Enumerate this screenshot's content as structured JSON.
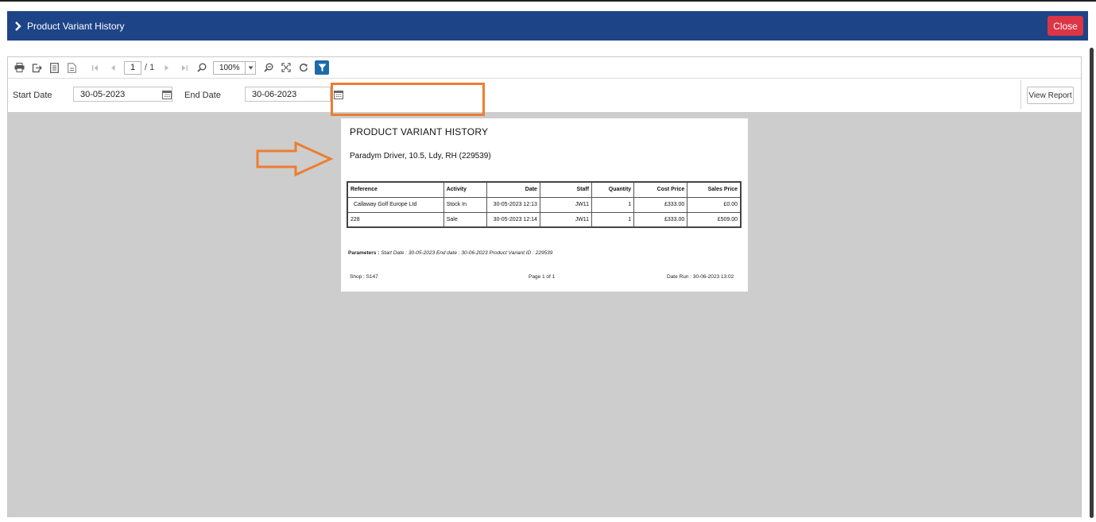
{
  "header": {
    "title": "Product Variant History",
    "close_label": "Close",
    "color": "#1e4488",
    "close_color": "#dc3545"
  },
  "toolbar": {
    "icons": [
      "print-icon",
      "export-icon",
      "document-map-icon",
      "page-setup-icon",
      "first-page-icon",
      "prev-page-icon",
      "next-page-icon",
      "last-page-icon",
      "search-icon",
      "zoom-out-icon",
      "fit-page-icon",
      "refresh-icon",
      "filter-icon"
    ],
    "page_current": "1",
    "page_total": "/ 1",
    "zoom": "100%"
  },
  "params": {
    "start_label": "Start Date",
    "start_value": "30-05-2023",
    "end_label": "End Date",
    "end_value": "30-06-2023",
    "view_report_label": "View Report"
  },
  "report": {
    "title": "PRODUCT VARIANT HISTORY",
    "product": "Paradym Driver, 10.5, Ldy, RH (229539)",
    "columns": [
      "Reference",
      "Activity",
      "Date",
      "Staff",
      "Quantity",
      "Cost Price",
      "Sales Price"
    ],
    "rows": [
      [
        "Callaway Golf Europe Ltd",
        "Stock In",
        "30-05-2023 12:13",
        "JW11",
        "1",
        "£333.00",
        "£0.00"
      ],
      [
        "228",
        "Sale",
        "30-05-2023 12:14",
        "JW11",
        "1",
        "£333.00",
        "£509.00"
      ]
    ],
    "parameters_label": "Parameters :",
    "parameters_text": "Start Date : 30-05-2023 End date : 30-06-2023   Product Variant ID : 229539",
    "shop": "Shop : S147",
    "page": "Page 1  of  1",
    "date_run": "Date Run : 30-06-2023 13:02"
  },
  "annotation": {
    "color": "#ed7d31"
  }
}
